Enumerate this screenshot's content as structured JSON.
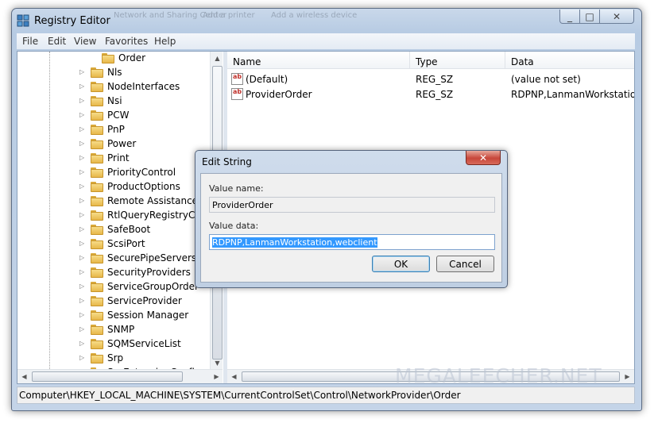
{
  "window": {
    "title": "Registry Editor",
    "background_ghost_text": [
      "Network and Sharing Center",
      "Add a printer",
      "Add a wireless device"
    ],
    "minimize_glyph": "_",
    "maximize_glyph": "□",
    "close_glyph": "✕"
  },
  "menu": [
    "File",
    "Edit",
    "View",
    "Favorites",
    "Help"
  ],
  "tree": {
    "selected": "Order",
    "items": [
      "Nls",
      "NodeInterfaces",
      "Nsi",
      "PCW",
      "PnP",
      "Power",
      "Print",
      "PriorityControl",
      "ProductOptions",
      "Remote Assistance",
      "RtlQueryRegistryConfi",
      "SafeBoot",
      "ScsiPort",
      "SecurePipeServers",
      "SecurityProviders",
      "ServiceGroupOrder",
      "ServiceProvider",
      "Session Manager",
      "SNMP",
      "SQMServiceList",
      "Srp",
      "SrpExtensionConfig"
    ]
  },
  "list": {
    "columns": [
      "Name",
      "Type",
      "Data"
    ],
    "rows": [
      {
        "name": "(Default)",
        "type": "REG_SZ",
        "data": "(value not set)"
      },
      {
        "name": "ProviderOrder",
        "type": "REG_SZ",
        "data": "RDPNP,LanmanWorkstation,webclient"
      }
    ]
  },
  "status": "Computer\\HKEY_LOCAL_MACHINE\\SYSTEM\\CurrentControlSet\\Control\\NetworkProvider\\Order",
  "watermark": "MEGALEECHER.NET",
  "dialog": {
    "title": "Edit String",
    "close_glyph": "✕",
    "value_name_label": "Value name:",
    "value_name": "ProviderOrder",
    "value_data_label": "Value data:",
    "value_data": "RDPNP,LanmanWorkstation,webclient",
    "ok": "OK",
    "cancel": "Cancel"
  },
  "scroll": {
    "up": "▲",
    "down": "▼",
    "left": "◀",
    "right": "▶"
  },
  "colors": {
    "selection": "#3399ff",
    "close_button": "#c7463a",
    "folder": "#e7b84a"
  }
}
